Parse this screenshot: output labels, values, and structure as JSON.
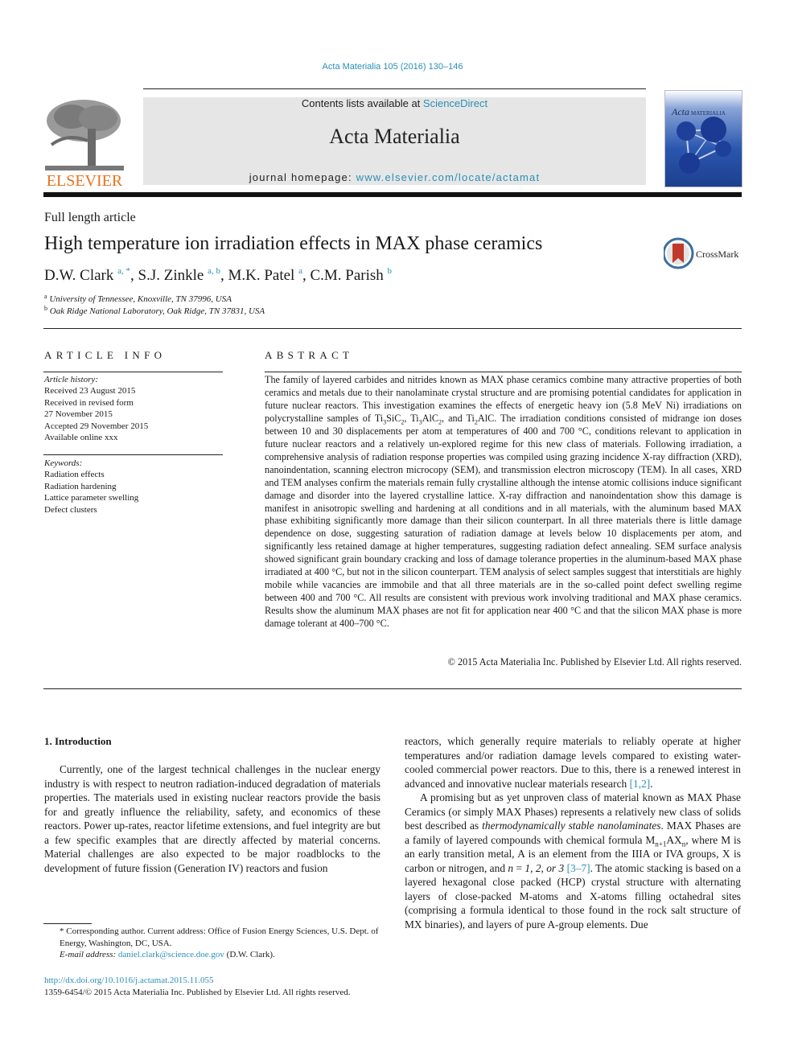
{
  "header": {
    "citation": "Acta Materialia 105 (2016) 130–146",
    "contents_prefix": "Contents lists available at ",
    "contents_link": "ScienceDirect",
    "journal_title": "Acta Materialia",
    "homepage_prefix": "journal homepage: ",
    "homepage_link": "www.elsevier.com/locate/actamat",
    "publisher_logo_text": "ELSEVIER",
    "cover_title_italic": "Acta",
    "cover_title_caps": "MATERIALIA",
    "crossmark_label": "CrossMark"
  },
  "article": {
    "type": "Full length article",
    "title": "High temperature ion irradiation effects in MAX phase ceramics",
    "authors": [
      {
        "name": "D.W. Clark",
        "sup": "a, *"
      },
      {
        "name": "S.J. Zinkle",
        "sup": "a, b"
      },
      {
        "name": "M.K. Patel",
        "sup": "a"
      },
      {
        "name": "C.M. Parish",
        "sup": "b"
      }
    ],
    "affiliations": [
      {
        "mark": "a",
        "text": "University of Tennessee, Knoxville, TN 37996, USA"
      },
      {
        "mark": "b",
        "text": "Oak Ridge National Laboratory, Oak Ridge, TN 37831, USA"
      }
    ]
  },
  "article_info": {
    "heading": "ARTICLE INFO",
    "history_label": "Article history:",
    "history": [
      "Received 23 August 2015",
      "Received in revised form",
      "27 November 2015",
      "Accepted 29 November 2015",
      "Available online xxx"
    ],
    "keywords_label": "Keywords:",
    "keywords": [
      "Radiation effects",
      "Radiation hardening",
      "Lattice parameter swelling",
      "Defect clusters"
    ]
  },
  "abstract": {
    "heading": "ABSTRACT",
    "part1": "The family of layered carbides and nitrides known as MAX phase ceramics combine many attractive properties of both ceramics and metals due to their nanolaminate crystal structure and are promising potential candidates for application in future nuclear reactors. This investigation examines the effects of energetic heavy ion (5.8 MeV Ni) irradiations on polycrystalline samples of ",
    "compounds": [
      {
        "parts": [
          [
            "Ti",
            ""
          ],
          [
            "3",
            "sub"
          ],
          [
            "SiC",
            ""
          ],
          [
            "2",
            "sub"
          ]
        ]
      },
      {
        "parts": [
          [
            "Ti",
            ""
          ],
          [
            "3",
            "sub"
          ],
          [
            "AlC",
            ""
          ],
          [
            "2",
            "sub"
          ]
        ]
      },
      {
        "parts": [
          [
            "Ti",
            ""
          ],
          [
            "2",
            "sub"
          ],
          [
            "AlC",
            ""
          ]
        ]
      }
    ],
    "sep1": ", ",
    "sep2": ", and ",
    "part2": ". The irradiation conditions consisted of midrange ion doses between 10 and 30 displacements per atom at temperatures of 400 and 700 °C, conditions relevant to application in future nuclear reactors and a relatively un-explored regime for this new class of materials. Following irradiation, a comprehensive analysis of radiation response properties was compiled using grazing incidence X-ray diffraction (XRD), nanoindentation, scanning electron microcopy (SEM), and transmission electron microscopy (TEM). In all cases, XRD and TEM analyses confirm the materials remain fully crystalline although the intense atomic collisions induce significant damage and disorder into the layered crystalline lattice. X-ray diffraction and nanoindentation show this damage is manifest in anisotropic swelling and hardening at all conditions and in all materials, with the aluminum based MAX phase exhibiting significantly more damage than their silicon counterpart. In all three materials there is little damage dependence on dose, suggesting saturation of radiation damage at levels below 10 displacements per atom, and significantly less retained damage at higher temperatures, suggesting radiation defect annealing. SEM surface analysis showed significant grain boundary cracking and loss of damage tolerance properties in the aluminum-based MAX phase irradiated at 400 °C, but not in the silicon counterpart. TEM analysis of select samples suggest that interstitials are highly mobile while vacancies are immobile and that all three materials are in the so-called point defect swelling regime between 400 and 700 °C. All results are consistent with previous work involving traditional and MAX phase ceramics. Results show the aluminum MAX phases are not fit for application near 400 °C and that the silicon MAX phase is more damage tolerant at 400–700 °C.",
    "copyright": "© 2015 Acta Materialia Inc. Published by Elsevier Ltd. All rights reserved."
  },
  "introduction": {
    "heading": "1.  Introduction",
    "left_para": "Currently, one of the largest technical challenges in the nuclear energy industry is with respect to neutron radiation-induced degradation of materials properties. The materials used in existing nuclear reactors provide the basis for and greatly influence the reliability, safety, and economics of these reactors. Power up-rates, reactor lifetime extensions, and fuel integrity are but a few specific examples that are directly affected by material concerns. Material challenges are also expected to be major roadblocks to the development of future fission (Generation IV) reactors and fusion",
    "right_para1": "reactors, which generally require materials to reliably operate at higher temperatures and/or radiation damage levels compared to existing water-cooled commercial power reactors. Due to this, there is a renewed interest in advanced and innovative nuclear materials research ",
    "right_para1_ref": "[1,2]",
    "right_para1_end": ".",
    "right_para2_a": "A promising but as yet unproven class of material known as MAX Phase Ceramics (or simply MAX Phases) represents a relatively new class of solids best described as ",
    "right_para2_italic": "thermodynamically stable nanolaminates",
    "right_para2_b": ". MAX Phases are a family of layered compounds with chemical formula M",
    "formula_sub1": "n+1",
    "formula_mid": "AX",
    "formula_sub2": "n",
    "right_para2_c": ", where M is an early transition metal, A is an element from the IIIA or IVA groups, X is carbon or nitrogen, and ",
    "n_var": "n",
    "n_eq": " = ",
    "n_values": "1, 2, or 3",
    "right_para2_ref": "[3–7]",
    "right_para2_d": ". The atomic stacking is based on a layered hexagonal close packed (HCP) crystal structure with alternating layers of close-packed M-atoms and X-atoms filling octahedral sites (comprising a formula identical to those found in the rock salt structure of MX binaries), and layers of pure A-group elements. Due"
  },
  "footnotes": {
    "corresponding": "* Corresponding author. Current address: Office of Fusion Energy Sciences, U.S. Dept. of Energy, Washington, DC, USA.",
    "email_label": "E-mail address: ",
    "email": "daniel.clark@science.doe.gov",
    "email_suffix": " (D.W. Clark).",
    "doi": "http://dx.doi.org/10.1016/j.actamat.2015.11.055",
    "issn_copyright": "1359-6454/© 2015 Acta Materialia Inc. Published by Elsevier Ltd. All rights reserved."
  },
  "colors": {
    "link": "#2a8fb8",
    "elsevier_orange": "#e9711c",
    "header_gray": "#e6e6e6",
    "crossmark_red": "#c0392b"
  }
}
